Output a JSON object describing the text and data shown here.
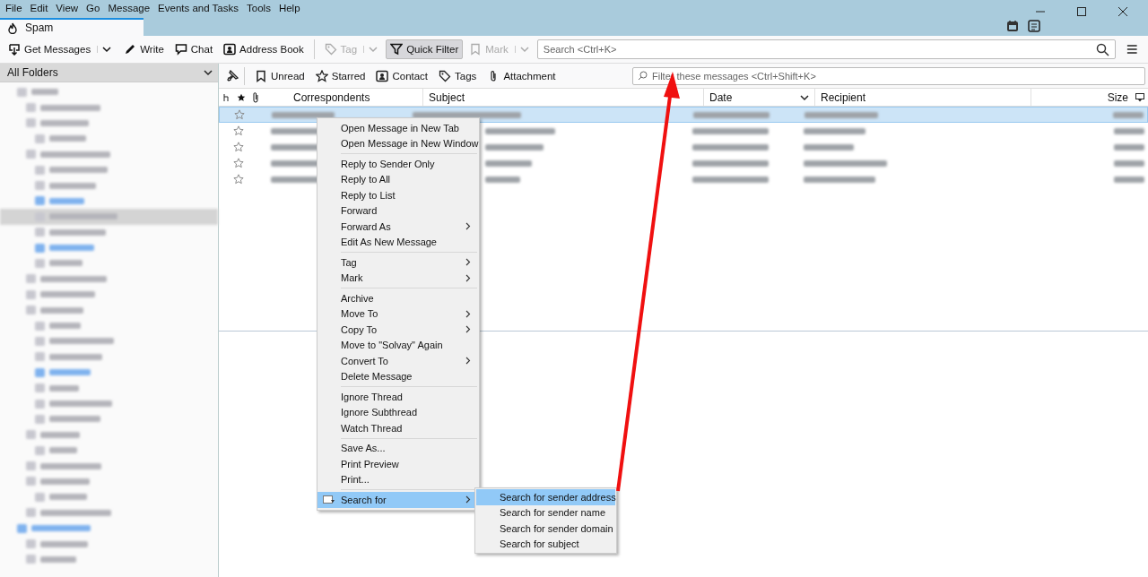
{
  "menubar": [
    "File",
    "Edit",
    "View",
    "Go",
    "Message",
    "Events and Tasks",
    "Tools",
    "Help"
  ],
  "tab": {
    "title": "Spam",
    "selected": true
  },
  "toolbar": {
    "buttons": [
      {
        "label": "Get Messages",
        "kind": "get",
        "dropdown": true,
        "disabled": false,
        "pressed": false
      },
      {
        "label": "Write",
        "kind": "write",
        "dropdown": false,
        "disabled": false,
        "pressed": false
      },
      {
        "label": "Chat",
        "kind": "chat",
        "dropdown": false,
        "disabled": false,
        "pressed": false
      },
      {
        "label": "Address Book",
        "kind": "contact",
        "dropdown": false,
        "disabled": false,
        "pressed": false
      },
      {
        "label": "Tag",
        "kind": "tag",
        "dropdown": true,
        "disabled": true,
        "pressed": false
      },
      {
        "label": "Quick Filter",
        "kind": "filter",
        "dropdown": false,
        "disabled": false,
        "pressed": true
      },
      {
        "label": "Mark",
        "kind": "mark",
        "dropdown": true,
        "disabled": true,
        "pressed": false
      }
    ],
    "search_placeholder": "Search <Ctrl+K>"
  },
  "folder_pane": {
    "title": "All Folders",
    "folders": [
      {
        "unread": false,
        "selected": false,
        "children": [
          {
            "unread": false,
            "selected": false
          },
          {
            "unread": false,
            "selected": false,
            "children": [
              {
                "unread": false,
                "selected": false
              }
            ]
          },
          {
            "unread": false,
            "selected": false,
            "children": [
              {
                "unread": false,
                "selected": false
              },
              {
                "unread": false,
                "selected": false
              },
              {
                "unread": true,
                "selected": false
              },
              {
                "unread": false,
                "selected": true
              },
              {
                "unread": false,
                "selected": false
              },
              {
                "unread": true,
                "selected": false
              },
              {
                "unread": false,
                "selected": false
              }
            ]
          },
          {
            "unread": false,
            "selected": false
          },
          {
            "unread": false,
            "selected": false
          },
          {
            "unread": false,
            "selected": false,
            "children": [
              {
                "unread": false,
                "selected": false
              },
              {
                "unread": false,
                "selected": false
              },
              {
                "unread": false,
                "selected": false
              },
              {
                "unread": true,
                "selected": false
              },
              {
                "unread": false,
                "selected": false
              },
              {
                "unread": false,
                "selected": false
              },
              {
                "unread": false,
                "selected": false
              }
            ]
          },
          {
            "unread": false,
            "selected": false,
            "children": [
              {
                "unread": false,
                "selected": false
              }
            ]
          },
          {
            "unread": false,
            "selected": false
          },
          {
            "unread": false,
            "selected": false,
            "children": [
              {
                "unread": false,
                "selected": false
              }
            ]
          },
          {
            "unread": false,
            "selected": false
          }
        ]
      },
      {
        "unread": true,
        "selected": false,
        "children": [
          {
            "unread": false,
            "selected": false
          },
          {
            "unread": false,
            "selected": false
          }
        ]
      }
    ]
  },
  "quick_filter": {
    "buttons": [
      {
        "label": "Unread",
        "kind": "unread"
      },
      {
        "label": "Starred",
        "kind": "star"
      },
      {
        "label": "Contact",
        "kind": "contact"
      },
      {
        "label": "Tags",
        "kind": "tag"
      },
      {
        "label": "Attachment",
        "kind": "attach"
      }
    ],
    "placeholder": "Filter these messages <Ctrl+Shift+K>"
  },
  "columns": [
    "Correspondents",
    "Subject",
    "Date",
    "Recipient",
    "Size"
  ],
  "messages": [
    {
      "selected": true
    },
    {
      "selected": false
    },
    {
      "selected": false
    },
    {
      "selected": false
    },
    {
      "selected": false
    }
  ],
  "context_menu": [
    {
      "kind": "item",
      "label": "Open Message in New Tab",
      "submenu": false,
      "selected": false
    },
    {
      "kind": "item",
      "label": "Open Message in New Window",
      "submenu": false,
      "selected": false
    },
    {
      "kind": "separator"
    },
    {
      "kind": "item",
      "label": "Reply to Sender Only",
      "submenu": false,
      "selected": false
    },
    {
      "kind": "item",
      "label": "Reply to All",
      "submenu": false,
      "selected": false
    },
    {
      "kind": "item",
      "label": "Reply to List",
      "submenu": false,
      "selected": false
    },
    {
      "kind": "item",
      "label": "Forward",
      "submenu": false,
      "selected": false
    },
    {
      "kind": "item",
      "label": "Forward As",
      "submenu": true,
      "selected": false
    },
    {
      "kind": "item",
      "label": "Edit As New Message",
      "submenu": false,
      "selected": false
    },
    {
      "kind": "separator"
    },
    {
      "kind": "item",
      "label": "Tag",
      "submenu": true,
      "selected": false
    },
    {
      "kind": "item",
      "label": "Mark",
      "submenu": true,
      "selected": false
    },
    {
      "kind": "separator"
    },
    {
      "kind": "item",
      "label": "Archive",
      "submenu": false,
      "selected": false
    },
    {
      "kind": "item",
      "label": "Move To",
      "submenu": true,
      "selected": false
    },
    {
      "kind": "item",
      "label": "Copy To",
      "submenu": true,
      "selected": false
    },
    {
      "kind": "item",
      "label": "Move to \"Solvay\" Again",
      "submenu": false,
      "selected": false
    },
    {
      "kind": "item",
      "label": "Convert To",
      "submenu": true,
      "selected": false
    },
    {
      "kind": "item",
      "label": "Delete Message",
      "submenu": false,
      "selected": false
    },
    {
      "kind": "separator"
    },
    {
      "kind": "item",
      "label": "Ignore Thread",
      "submenu": false,
      "selected": false
    },
    {
      "kind": "item",
      "label": "Ignore Subthread",
      "submenu": false,
      "selected": false
    },
    {
      "kind": "item",
      "label": "Watch Thread",
      "submenu": false,
      "selected": false
    },
    {
      "kind": "separator"
    },
    {
      "kind": "item",
      "label": "Save As...",
      "submenu": false,
      "selected": false
    },
    {
      "kind": "item",
      "label": "Print Preview",
      "submenu": false,
      "selected": false
    },
    {
      "kind": "item",
      "label": "Print...",
      "submenu": false,
      "selected": false
    },
    {
      "kind": "separator"
    },
    {
      "kind": "item",
      "label": "Search for",
      "submenu": true,
      "selected": true,
      "icon": true
    }
  ],
  "submenu": [
    {
      "label": "Search for sender address",
      "selected": true
    },
    {
      "label": "Search for sender name",
      "selected": false
    },
    {
      "label": "Search for sender domain",
      "selected": false
    },
    {
      "label": "Search for subject",
      "selected": false
    }
  ]
}
